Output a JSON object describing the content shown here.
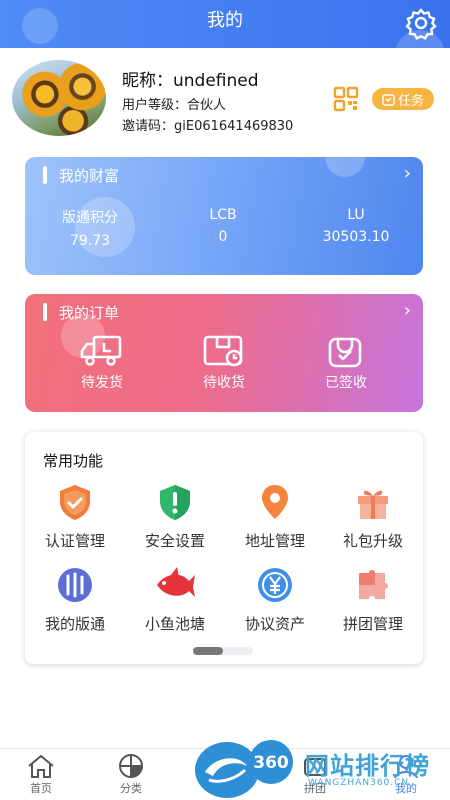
{
  "header": {
    "title": "我的"
  },
  "profile": {
    "nickname": "昵称：undefined",
    "level": "用户等级：合伙人",
    "invite": "邀请码：giE061641469830",
    "task_label": "任务"
  },
  "wealth": {
    "title": "我的财富",
    "items": [
      {
        "label": "版通积分",
        "value": "79.73"
      },
      {
        "label": "LCB",
        "value": "0"
      },
      {
        "label": "LU",
        "value": "30503.10"
      }
    ]
  },
  "orders": {
    "title": "我的订单",
    "items": [
      {
        "label": "待发货"
      },
      {
        "label": "待收货"
      },
      {
        "label": "已签收"
      }
    ]
  },
  "functions": {
    "title": "常用功能",
    "items": [
      {
        "label": "认证管理"
      },
      {
        "label": "安全设置"
      },
      {
        "label": "地址管理"
      },
      {
        "label": "礼包升级"
      },
      {
        "label": "我的版通"
      },
      {
        "label": "小鱼池塘"
      },
      {
        "label": "协议资产"
      },
      {
        "label": "拼团管理"
      }
    ]
  },
  "tabbar": {
    "items": [
      {
        "label": "首页"
      },
      {
        "label": "分类"
      },
      {
        "label": "拼团"
      },
      {
        "label": "我的"
      }
    ]
  },
  "watermark": {
    "text": "网站排行榜",
    "url": "WANGZHAN360.CN"
  },
  "colors": {
    "primary": "#4682f0",
    "task": "#f7b443",
    "order_start": "#f2707a",
    "order_end": "#c674dd"
  }
}
